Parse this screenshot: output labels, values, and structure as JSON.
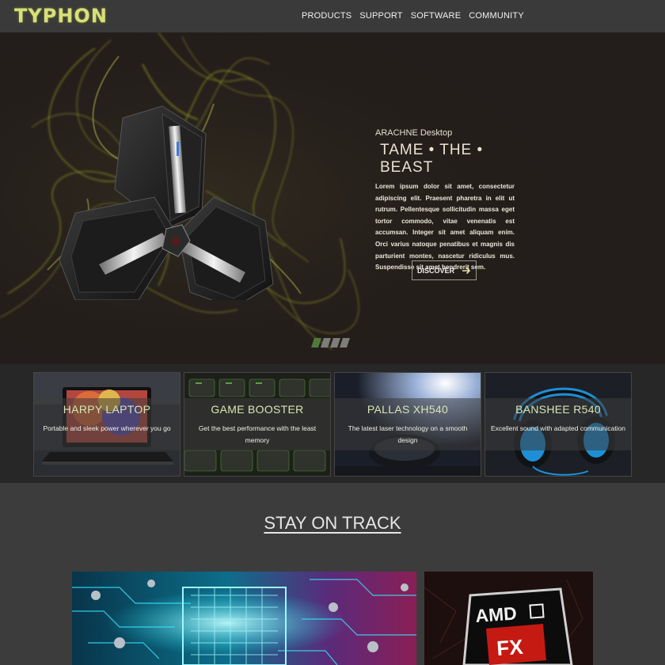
{
  "nav": {
    "logo": "TYPHON",
    "items": [
      {
        "label": "PRODUCTS"
      },
      {
        "label": "SUPPORT"
      },
      {
        "label": "SOFTWARE"
      },
      {
        "label": "COMMUNITY"
      }
    ]
  },
  "hero": {
    "kicker": "ARACHNE Desktop",
    "title": "TAME • THE • BEAST",
    "body": "Lorem ipsum dolor sit amet, consectetur adipiscing elit. Praesent pharetra in elit ut rutrum. Pellentesque sollicitudin massa eget tortor commodo, vitae venenatis est accumsan. Integer sit amet aliquam enim. Orci varius natoque penatibus et magnis dis parturient montes, nascetur ridiculus mus. Suspendisse sit amet hendrerit sem.",
    "cta_label": "DISCOVER",
    "cta_icon": "arrow-right-icon",
    "slides_total": 4,
    "slide_active": 1
  },
  "products": [
    {
      "title": "HARPY LAPTOP",
      "desc": "Portable and sleek power wherever you go"
    },
    {
      "title": "GAME BOOSTER",
      "desc": "Get the best performance with the least memory"
    },
    {
      "title": "PALLAS XH540",
      "desc": "The latest laser technology on a smooth design"
    },
    {
      "title": "BANSHEE R540",
      "desc": "Excellent sound with adapted communication"
    }
  ],
  "section": {
    "title": "STAY ON TRACK"
  },
  "colors": {
    "accent": "#d9df7a",
    "smoke": "#b8c22a",
    "background": "#3c3c3c",
    "nav": "#3a3a3a",
    "hero": "#231d1b"
  }
}
